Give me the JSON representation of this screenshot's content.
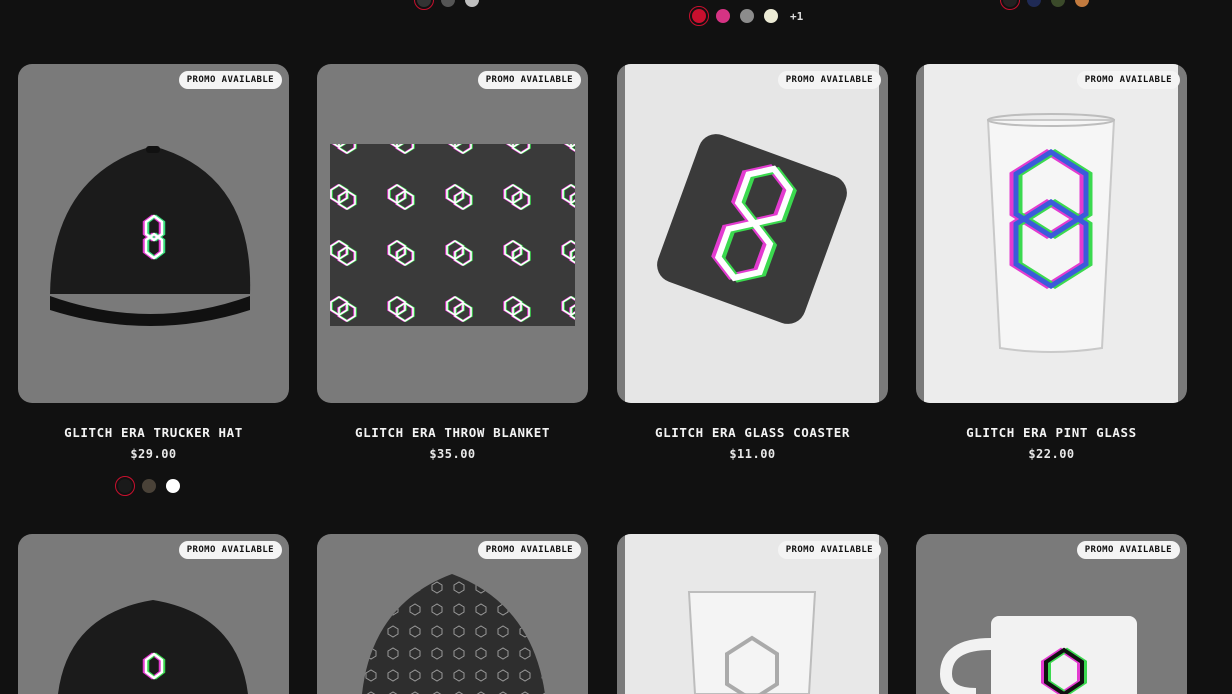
{
  "top_swatches": {
    "row1": [
      "#333333",
      "#555555",
      "#bfbfbf"
    ],
    "row2": [
      "#c8102e",
      "#d63384",
      "#8c8c8c",
      "#ecebd5"
    ],
    "row2_more": "+1",
    "row3": [
      "#222222",
      "#1f2a55",
      "#3b4a2a",
      "#c27a3e"
    ]
  },
  "products": [
    {
      "title": "GLITCH ERA TRUCKER HAT",
      "price": "$29.00",
      "badge": "PROMO AVAILABLE",
      "bg": "#7a7a7a",
      "swatches": [
        "#1a1a1a",
        "#4a4238",
        "#ffffff"
      ]
    },
    {
      "title": "GLITCH ERA THROW BLANKET",
      "price": "$35.00",
      "badge": "PROMO AVAILABLE",
      "bg": "#7a7a7a"
    },
    {
      "title": "GLITCH ERA GLASS COASTER",
      "price": "$11.00",
      "badge": "PROMO AVAILABLE",
      "bg": "#e6e6e6"
    },
    {
      "title": "GLITCH ERA PINT GLASS",
      "price": "$22.00",
      "badge": "PROMO AVAILABLE",
      "bg": "#ececec"
    },
    {
      "badge": "PROMO AVAILABLE",
      "bg": "#7a7a7a"
    },
    {
      "badge": "PROMO AVAILABLE",
      "bg": "#7a7a7a"
    },
    {
      "badge": "PROMO AVAILABLE",
      "bg": "#e8e8e8"
    },
    {
      "badge": "PROMO AVAILABLE",
      "bg": "#7a7a7a"
    }
  ]
}
